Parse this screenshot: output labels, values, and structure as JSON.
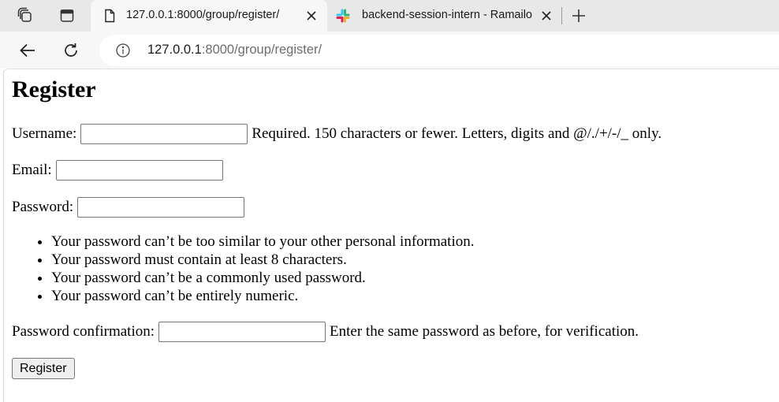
{
  "browser": {
    "tabs": [
      {
        "title": "127.0.0.1:8000/group/register/",
        "active": true,
        "icon": "document-icon"
      },
      {
        "title": "backend-session-intern - Ramailo",
        "active": false,
        "icon": "slack-icon"
      }
    ],
    "address": {
      "host": "127.0.0.1",
      "rest": ":8000/group/register/"
    }
  },
  "page": {
    "heading": "Register",
    "username": {
      "label": "Username:",
      "value": "",
      "help": "Required. 150 characters or fewer. Letters, digits and @/./+/-/_ only."
    },
    "email": {
      "label": "Email:",
      "value": ""
    },
    "password": {
      "label": "Password:",
      "value": ""
    },
    "password_help": [
      "Your password can’t be too similar to your other personal information.",
      "Your password must contain at least 8 characters.",
      "Your password can’t be a commonly used password.",
      "Your password can’t be entirely numeric."
    ],
    "password_confirmation": {
      "label": "Password confirmation:",
      "value": "",
      "help": "Enter the same password as before, for verification."
    },
    "submit_label": "Register"
  },
  "colors": {
    "tabstrip_bg": "#e8e8e8",
    "toolbar_bg": "#f7f7f7",
    "url_host": "#1b1b1b",
    "url_rest": "#6d6d6d"
  }
}
